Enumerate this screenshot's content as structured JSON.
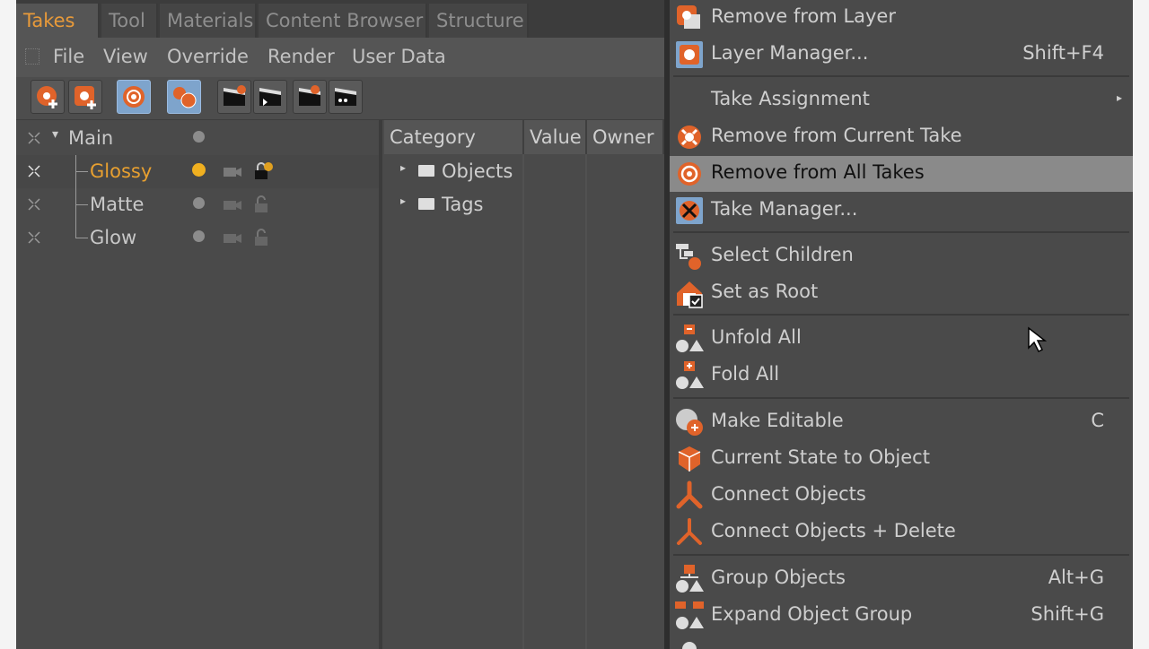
{
  "tabs": [
    "Takes",
    "Tool",
    "Materials",
    "Content Browser",
    "Structure"
  ],
  "menu": [
    "File",
    "View",
    "Override",
    "Render",
    "User Data"
  ],
  "toolbar_icons": [
    "add-take-icon",
    "add-take-child-icon",
    "auto-take-icon",
    "override-group-icon",
    "clapper-icon",
    "clapper-icon",
    "clapper-icon",
    "clapper-icon"
  ],
  "takes": [
    {
      "name": "Main",
      "state": "inactive"
    },
    {
      "name": "Glossy",
      "state": "active"
    },
    {
      "name": "Matte",
      "state": "inactive"
    },
    {
      "name": "Glow",
      "state": "inactive"
    }
  ],
  "props": {
    "headers": [
      "Category",
      "Value",
      "Owner"
    ],
    "items": [
      "Objects",
      "Tags"
    ]
  },
  "context_menu": {
    "items": [
      {
        "label": "Remove from Layer",
        "shortcut": "",
        "icon": "layer-remove-icon"
      },
      {
        "label": "Layer Manager...",
        "shortcut": "Shift+F4",
        "icon": "layer-manager-icon"
      },
      {
        "label": "Take Assignment",
        "shortcut": "",
        "icon": "",
        "submenu": true
      },
      {
        "label": "Remove from Current Take",
        "shortcut": "",
        "icon": "remove-current-take-icon"
      },
      {
        "label": "Remove from All Takes",
        "shortcut": "",
        "icon": "remove-all-takes-icon",
        "hover": true
      },
      {
        "label": "Take Manager...",
        "shortcut": "",
        "icon": "take-manager-icon"
      },
      {
        "label": "Select Children",
        "shortcut": "",
        "icon": "select-children-icon"
      },
      {
        "label": "Set as Root",
        "shortcut": "",
        "icon": "set-root-icon"
      },
      {
        "label": "Unfold All",
        "shortcut": "",
        "icon": "unfold-all-icon"
      },
      {
        "label": "Fold All",
        "shortcut": "",
        "icon": "fold-all-icon"
      },
      {
        "label": "Make Editable",
        "shortcut": "C",
        "icon": "make-editable-icon"
      },
      {
        "label": "Current State to Object",
        "shortcut": "",
        "icon": "current-state-icon"
      },
      {
        "label": "Connect Objects",
        "shortcut": "",
        "icon": "connect-objects-icon"
      },
      {
        "label": "Connect Objects + Delete",
        "shortcut": "",
        "icon": "connect-delete-icon"
      },
      {
        "label": "Group Objects",
        "shortcut": "Alt+G",
        "icon": "group-objects-icon"
      },
      {
        "label": "Expand Object Group",
        "shortcut": "Shift+G",
        "icon": "expand-group-icon"
      }
    ]
  },
  "colors": {
    "accent": "#e8a030",
    "panel": "#4a4a4a",
    "hover": "#8a8a8a",
    "highlight_button": "#7ea4cc"
  }
}
